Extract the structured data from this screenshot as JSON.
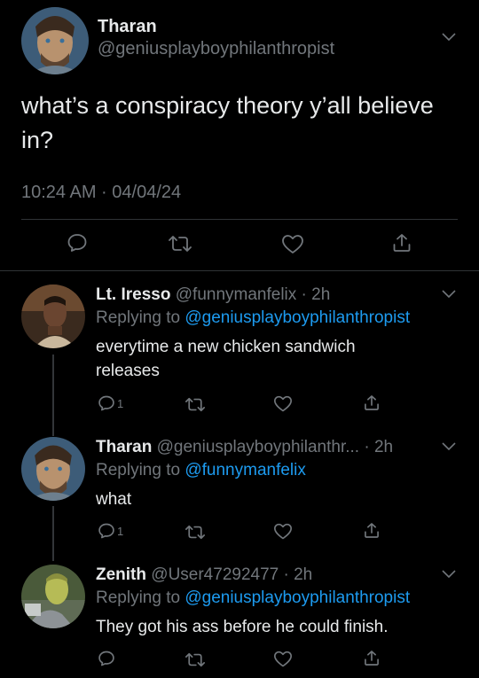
{
  "main_tweet": {
    "display_name": "Tharan",
    "handle": "@geniusplayboyphilanthropist",
    "text_line1": "what’s a conspiracy theory y’all believe",
    "text_line2": "in?",
    "timestamp": "10:24 AM · 04/04/24"
  },
  "replies": [
    {
      "display_name": "Lt. Iresso",
      "meta": "@funnymanfelix · 2h",
      "replying_prefix": "Replying to ",
      "replying_handle": "@geniusplayboyphilanthropist",
      "text_line1": "everytime a new chicken sandwich",
      "text_line2": "releases",
      "reply_count": "1"
    },
    {
      "display_name": "Tharan",
      "meta": "@geniusplayboyphilanthr... · 2h",
      "replying_prefix": "Replying to ",
      "replying_handle": "@funnymanfelix",
      "text_line1": "what",
      "reply_count": "1"
    },
    {
      "display_name": "Zenith",
      "meta": "@User47292477 · 2h",
      "replying_prefix": "Replying to ",
      "replying_handle": "@geniusplayboyphilanthropist",
      "text_line1": "They got his ass before he could finish.",
      "reply_count": ""
    }
  ],
  "colors": {
    "background": "#000000",
    "text": "#e7e9ea",
    "muted": "#71767b",
    "link": "#1d9bf0",
    "divider": "#2f3336"
  },
  "icons": [
    "reply-icon",
    "retweet-icon",
    "like-icon",
    "share-icon",
    "chevron-down-icon"
  ]
}
